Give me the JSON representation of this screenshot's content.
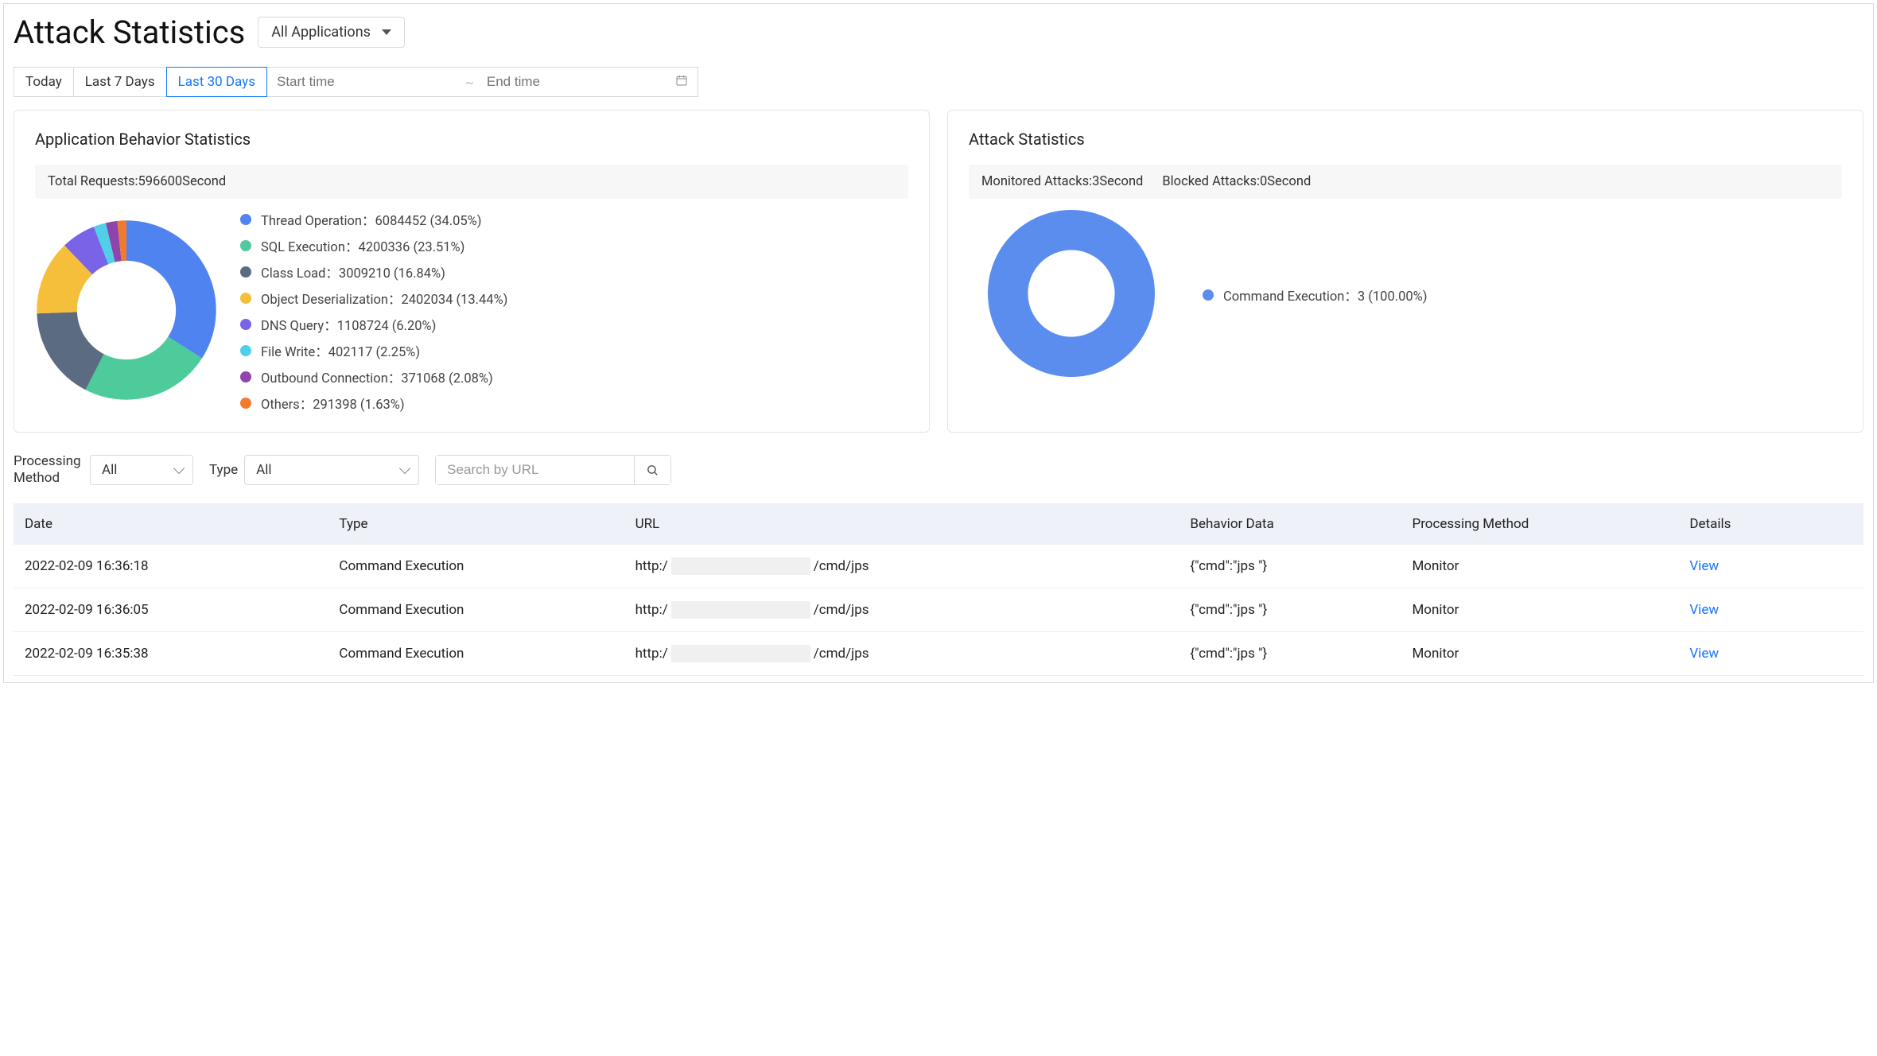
{
  "header": {
    "title": "Attack Statistics",
    "app_select_label": "All Applications"
  },
  "time_tabs": {
    "today": "Today",
    "last7": "Last 7 Days",
    "last30": "Last 30 Days",
    "active": "last30"
  },
  "range_picker": {
    "start_placeholder": "Start time",
    "sep": "~",
    "end_placeholder": "End time"
  },
  "behavior_card": {
    "title": "Application Behavior Statistics",
    "summary": "Total Requests:596600Second"
  },
  "attack_card": {
    "title": "Attack Statistics",
    "monitored": "Monitored Attacks:3Second",
    "blocked": "Blocked Attacks:0Second"
  },
  "chart_data": [
    {
      "type": "pie",
      "title": "Application Behavior Statistics",
      "series": [
        {
          "name": "Thread Operation",
          "value": 6084452,
          "pct": 34.05,
          "color": "#4f83f0"
        },
        {
          "name": "SQL Execution",
          "value": 4200336,
          "pct": 23.51,
          "color": "#4ecb9b"
        },
        {
          "name": "Class Load",
          "value": 3009210,
          "pct": 16.84,
          "color": "#5b6b82"
        },
        {
          "name": "Object Deserialization",
          "value": 2402034,
          "pct": 13.44,
          "color": "#f5bf3b"
        },
        {
          "name": "DNS Query",
          "value": 1108724,
          "pct": 6.2,
          "color": "#7a63e6"
        },
        {
          "name": "File Write",
          "value": 402117,
          "pct": 2.25,
          "color": "#4fd0e8"
        },
        {
          "name": "Outbound Connection",
          "value": 371068,
          "pct": 2.08,
          "color": "#8e44ad"
        },
        {
          "name": "Others",
          "value": 291398,
          "pct": 1.63,
          "color": "#f07b2e"
        }
      ]
    },
    {
      "type": "pie",
      "title": "Attack Statistics",
      "series": [
        {
          "name": "Command Execution",
          "value": 3,
          "pct": 100.0,
          "color": "#5a8dee"
        }
      ]
    }
  ],
  "filters": {
    "processing_label": "Processing Method",
    "processing_value": "All",
    "type_label": "Type",
    "type_value": "All",
    "search_placeholder": "Search by URL"
  },
  "table": {
    "columns": {
      "date": "Date",
      "type": "Type",
      "url": "URL",
      "behavior": "Behavior Data",
      "method": "Processing Method",
      "details": "Details"
    },
    "url_prefix": "http:/",
    "url_suffix": "/cmd/jps",
    "view_label": "View",
    "rows": [
      {
        "date": "2022-02-09 16:36:18",
        "type": "Command Execution",
        "behavior": "{\"cmd\":\"jps \"}",
        "method": "Monitor"
      },
      {
        "date": "2022-02-09 16:36:05",
        "type": "Command Execution",
        "behavior": "{\"cmd\":\"jps \"}",
        "method": "Monitor"
      },
      {
        "date": "2022-02-09 16:35:38",
        "type": "Command Execution",
        "behavior": "{\"cmd\":\"jps \"}",
        "method": "Monitor"
      }
    ]
  }
}
